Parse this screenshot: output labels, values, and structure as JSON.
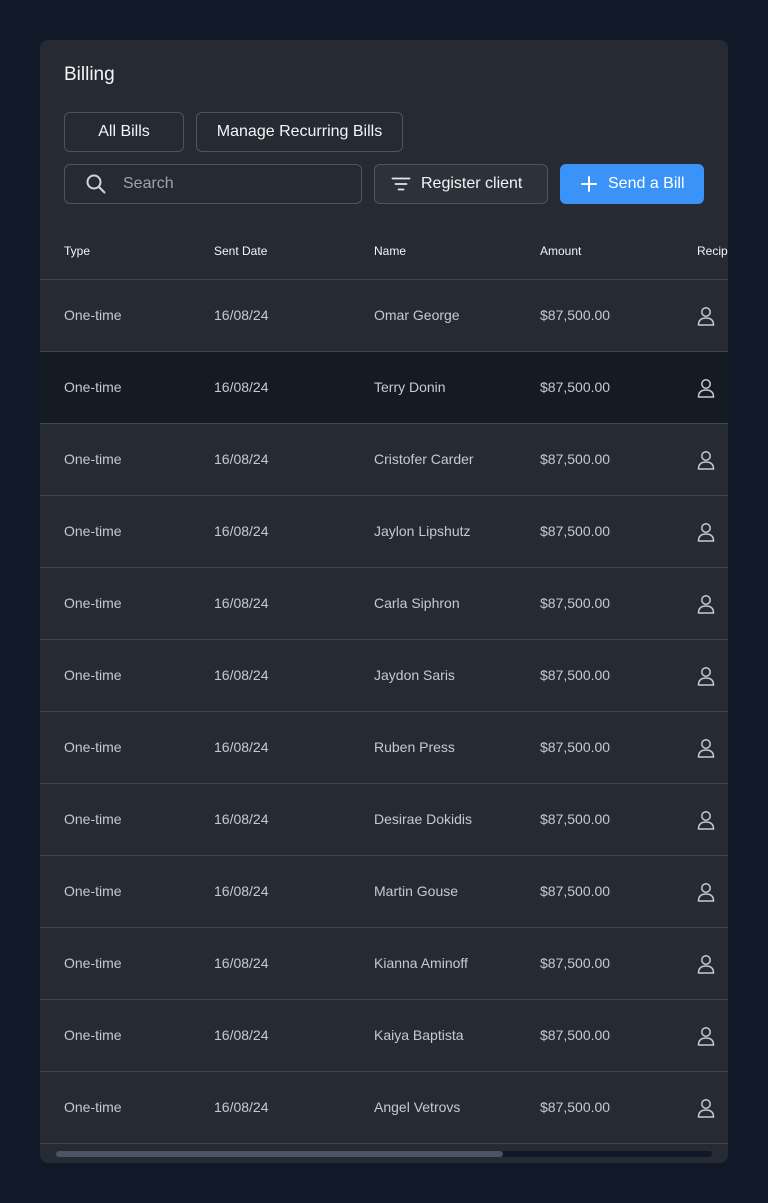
{
  "header": {
    "title": "Billing"
  },
  "tabs": {
    "all_bills": "All Bills",
    "manage_recurring": "Manage Recurring Bills"
  },
  "toolbar": {
    "search_placeholder": "Search",
    "register_label": "Register client",
    "send_label": "Send a Bill",
    "accent_color": "#3b93f7"
  },
  "table": {
    "headers": {
      "type": "Type",
      "sent_date": "Sent Date",
      "name": "Name",
      "amount": "Amount",
      "recipient": "Recip"
    },
    "rows": [
      {
        "type": "One-time",
        "date": "16/08/24",
        "name": "Omar George",
        "amount": "$87,500.00",
        "icon": "user-icon"
      },
      {
        "type": "One-time",
        "date": "16/08/24",
        "name": "Terry Donin",
        "amount": "$87,500.00",
        "icon": "user-icon",
        "selected": true
      },
      {
        "type": "One-time",
        "date": "16/08/24",
        "name": "Cristofer Carder",
        "amount": "$87,500.00",
        "icon": "user-icon"
      },
      {
        "type": "One-time",
        "date": "16/08/24",
        "name": "Jaylon Lipshutz",
        "amount": "$87,500.00",
        "icon": "user-icon"
      },
      {
        "type": "One-time",
        "date": "16/08/24",
        "name": "Carla Siphron",
        "amount": "$87,500.00",
        "icon": "user-icon"
      },
      {
        "type": "One-time",
        "date": "16/08/24",
        "name": "Jaydon Saris",
        "amount": "$87,500.00",
        "icon": "user-icon"
      },
      {
        "type": "One-time",
        "date": "16/08/24",
        "name": "Ruben Press",
        "amount": "$87,500.00",
        "icon": "user-icon"
      },
      {
        "type": "One-time",
        "date": "16/08/24",
        "name": "Desirae Dokidis",
        "amount": "$87,500.00",
        "icon": "user-icon"
      },
      {
        "type": "One-time",
        "date": "16/08/24",
        "name": "Martin Gouse",
        "amount": "$87,500.00",
        "icon": "user-icon"
      },
      {
        "type": "One-time",
        "date": "16/08/24",
        "name": "Kianna Aminoff",
        "amount": "$87,500.00",
        "icon": "user-icon"
      },
      {
        "type": "One-time",
        "date": "16/08/24",
        "name": "Kaiya Baptista",
        "amount": "$87,500.00",
        "icon": "user-icon"
      },
      {
        "type": "One-time",
        "date": "16/08/24",
        "name": "Angel Vetrovs",
        "amount": "$87,500.00",
        "icon": "user-icon"
      }
    ]
  }
}
